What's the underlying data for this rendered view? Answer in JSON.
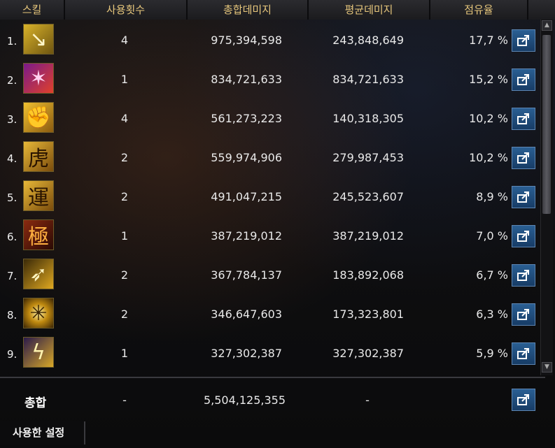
{
  "header": {
    "skill": "스킬",
    "uses": "사용횟수",
    "total": "총합데미지",
    "avg": "평균데미지",
    "share": "점유율"
  },
  "rows": [
    {
      "rank": "1.",
      "icon": "lightning-slash-icon",
      "glyph": "↘",
      "uses": "4",
      "total": "975,394,598",
      "avg": "243,848,649",
      "share": "17,7 %"
    },
    {
      "rank": "2.",
      "icon": "purple-claw-icon",
      "glyph": "✶",
      "uses": "1",
      "total": "834,721,633",
      "avg": "834,721,633",
      "share": "15,2 %"
    },
    {
      "rank": "3.",
      "icon": "golden-fist-icon",
      "glyph": "✊",
      "uses": "4",
      "total": "561,273,223",
      "avg": "140,318,305",
      "share": "10,2 %"
    },
    {
      "rank": "4.",
      "icon": "tiger-hanja-icon",
      "glyph": "虎",
      "uses": "2",
      "total": "559,974,906",
      "avg": "279,987,453",
      "share": "10,2 %"
    },
    {
      "rank": "5.",
      "icon": "fortune-hanja-icon",
      "glyph": "運",
      "uses": "2",
      "total": "491,047,215",
      "avg": "245,523,607",
      "share": "8,9 %"
    },
    {
      "rank": "6.",
      "icon": "extreme-hanja-icon",
      "glyph": "極",
      "uses": "1",
      "total": "387,219,012",
      "avg": "387,219,012",
      "share": "7,0 %"
    },
    {
      "rank": "7.",
      "icon": "golden-kick-icon",
      "glyph": "➶",
      "uses": "2",
      "total": "367,784,137",
      "avg": "183,892,068",
      "share": "6,7 %"
    },
    {
      "rank": "8.",
      "icon": "burst-strike-icon",
      "glyph": "✳",
      "uses": "2",
      "total": "346,647,603",
      "avg": "173,323,801",
      "share": "6,3 %"
    },
    {
      "rank": "9.",
      "icon": "lightning-bolt-icon",
      "glyph": "ϟ",
      "uses": "1",
      "total": "327,302,387",
      "avg": "327,302,387",
      "share": "5,9 %"
    }
  ],
  "summary": {
    "label": "총합",
    "uses": "-",
    "total": "5,504,125,355",
    "avg": "-"
  },
  "footer": {
    "tab_label": "사용한 설정"
  },
  "colors": {
    "header_text": "#e7c77c",
    "share_button": "#1f4d7d",
    "background": "#0b0b0d"
  }
}
